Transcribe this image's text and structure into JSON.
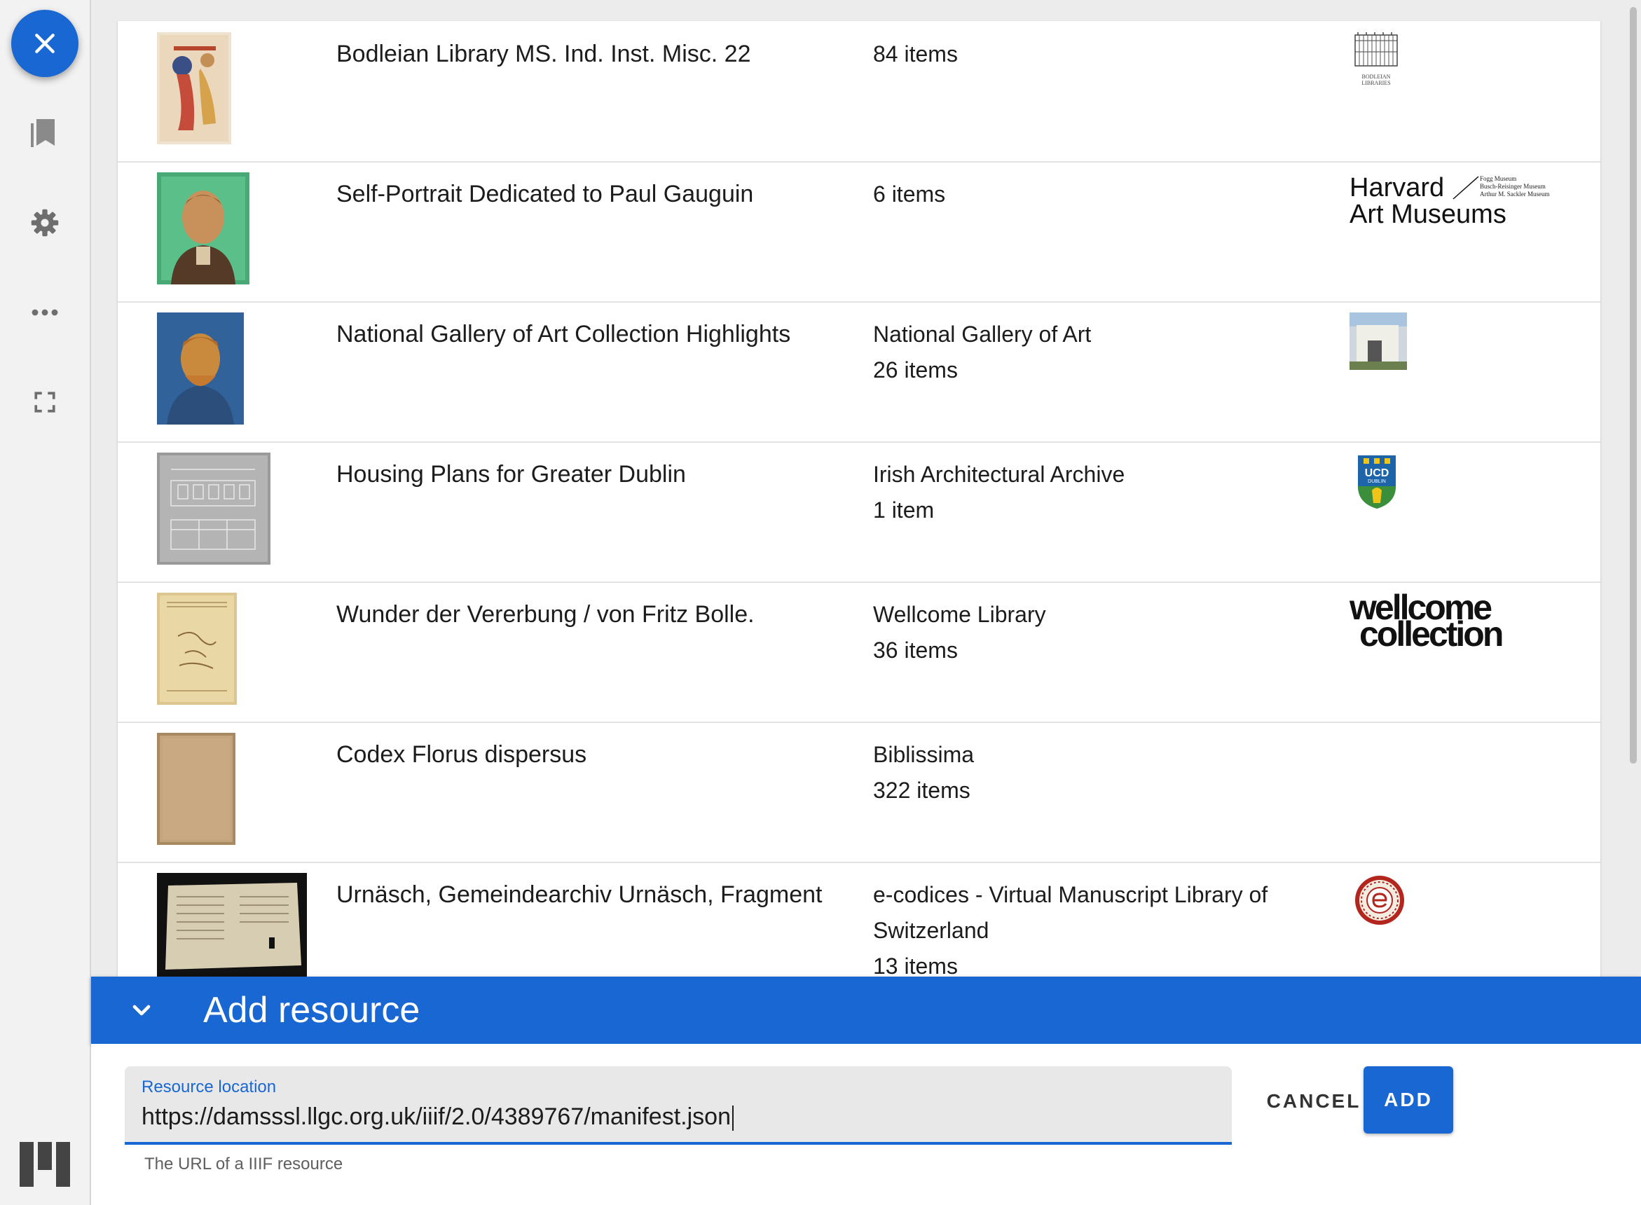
{
  "rail": {
    "icons": [
      "close-icon",
      "bookmark-icon",
      "gear-icon",
      "more-icon",
      "fullscreen-icon",
      "mirador-logo-icon"
    ]
  },
  "resources": [
    {
      "title": "Bodleian Library MS. Ind. Inst. Misc. 22",
      "provider": "",
      "count": "84 items",
      "logo": "BODLEIAN LIBRARIES"
    },
    {
      "title": "Self-Portrait Dedicated to Paul Gauguin",
      "provider": "",
      "count": "6 items",
      "logo_line1": "Harvard",
      "logo_line2": "Art Museums",
      "logo_small1": "Fogg Museum",
      "logo_small2": "Busch-Reisinger Museum",
      "logo_small3": "Arthur M. Sackler Museum"
    },
    {
      "title": "National Gallery of Art Collection Highlights",
      "provider": "National Gallery of Art",
      "count": "26 items"
    },
    {
      "title": "Housing Plans for Greater Dublin",
      "provider": "Irish Architectural Archive",
      "count": "1 item",
      "logo_text": "UCD",
      "logo_sub": "DUBLIN"
    },
    {
      "title": "Wunder der Vererbung / von Fritz Bolle.",
      "provider": "Wellcome Library",
      "count": "36 items",
      "logo_line1": "wellcome",
      "logo_line2": "collection"
    },
    {
      "title": "Codex Florus dispersus",
      "provider": "Biblissima",
      "count": "322 items"
    },
    {
      "title": "Urnäsch, Gemeindearchiv Urnäsch, Fragment",
      "provider": "e-codices - Virtual Manuscript Library of Switzerland",
      "count": "13 items"
    }
  ],
  "add_bar": {
    "title": "Add resource"
  },
  "form": {
    "label": "Resource location",
    "value": "https://damsssl.llgc.org.uk/iiif/2.0/4389767/manifest.json",
    "helper": "The URL of a IIIF resource",
    "cancel": "CANCEL",
    "add": "ADD"
  },
  "colors": {
    "accent": "#1967d2"
  }
}
